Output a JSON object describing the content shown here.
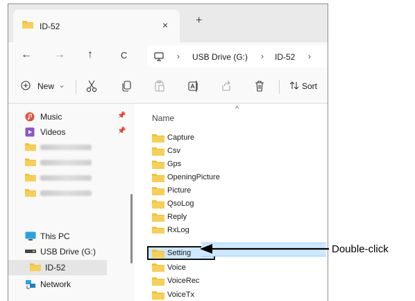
{
  "tab": {
    "title": "ID-52",
    "close_glyph": "×",
    "new_glyph": "+"
  },
  "nav": {
    "back_glyph": "←",
    "forward_glyph": "→",
    "up_glyph": "↑",
    "refresh_glyph": "C",
    "breadcrumbs": [
      "USB Drive (G:)",
      "ID-52"
    ],
    "separator": "›"
  },
  "toolbar": {
    "new_label": "New",
    "new_caret": "⌄",
    "sort_label": "Sort"
  },
  "sidebar": {
    "pin_glyph": "📌",
    "items": [
      {
        "label": "Music",
        "icon": "music-icon",
        "pinned": true
      },
      {
        "label": "Videos",
        "icon": "videos-icon",
        "pinned": true
      },
      {
        "label": "",
        "icon": "folder-icon",
        "blurred": true
      },
      {
        "label": "",
        "icon": "folder-icon",
        "blurred": true
      },
      {
        "label": "",
        "icon": "folder-icon",
        "blurred": true
      },
      {
        "label": "",
        "icon": "folder-icon",
        "blurred": true
      },
      {
        "label": "This PC",
        "icon": "pc-icon"
      },
      {
        "label": "USB Drive (G:)",
        "icon": "drive-icon"
      },
      {
        "label": "ID-52",
        "icon": "folder-icon",
        "selected": true
      },
      {
        "label": "Network",
        "icon": "network-icon"
      }
    ]
  },
  "files": {
    "column_header": "Name",
    "sort_caret": "^",
    "items": [
      "Capture",
      "Csv",
      "Gps",
      "OpeningPicture",
      "Picture",
      "QsoLog",
      "Reply",
      "RxLog",
      "Setting",
      "Voice",
      "VoiceRec",
      "VoiceTx"
    ],
    "selected": "Setting"
  },
  "annotation": {
    "label": "Double-click"
  },
  "colors": {
    "folder": "#f2c037",
    "selection": "#cde8ff",
    "accent": "#0067c0"
  }
}
